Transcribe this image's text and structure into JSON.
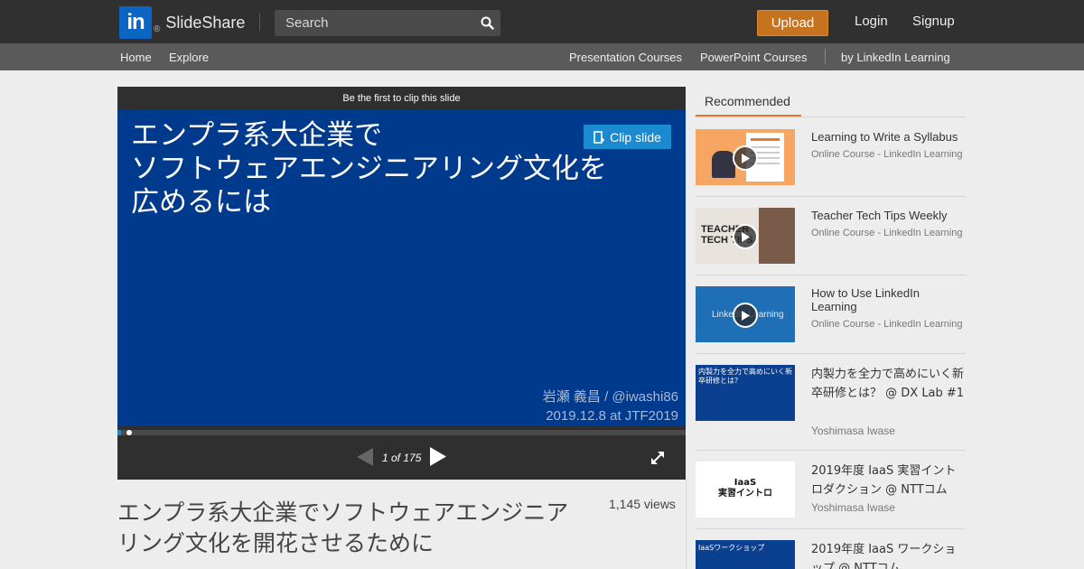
{
  "header": {
    "logo_in": "in",
    "logo_reg": "®",
    "logo_text": "SlideShare",
    "search_placeholder": "Search",
    "upload_label": "Upload",
    "login_label": "Login",
    "signup_label": "Signup"
  },
  "subnav": {
    "home": "Home",
    "explore": "Explore",
    "presentation_courses": "Presentation Courses",
    "powerpoint_courses": "PowerPoint Courses",
    "linkedin_learning": "by LinkedIn Learning"
  },
  "player": {
    "clip_banner": "Be the first to clip this slide",
    "clip_button": "Clip slide",
    "slide_title_lines": [
      "エンプラ系大企業で",
      "ソフトウェアエンジニアリング文化を",
      "広めるには"
    ],
    "slide_author": "岩瀬 義昌 / @iwashi86",
    "slide_date": "2019.12.8 at JTF2019",
    "counter": "1 of 175",
    "current_slide": 1,
    "total_slides": 175
  },
  "deck": {
    "title": "エンプラ系大企業でソフトウェアエンジニアリング文化を開花させるために",
    "views": "1,145 views"
  },
  "sidebar": {
    "tab_label": "Recommended",
    "items": [
      {
        "title": "Learning to Write a Syllabus",
        "subtitle": "Online Course - LinkedIn Learning"
      },
      {
        "title": "Teacher Tech Tips Weekly",
        "subtitle": "Online Course - LinkedIn Learning",
        "thumb_text": "TEACHER TECH TIPS"
      },
      {
        "title": "How to Use LinkedIn Learning",
        "subtitle": "Online Course - LinkedIn Learning",
        "thumb_text": "LinkedIn Learning"
      },
      {
        "title": "内製力を全力で高めにいく新卒研修とは？ @ DX Lab #1",
        "subtitle": "Yoshimasa Iwase",
        "thumb_text": "内製力を全力で高めにいく新卒研修とは？"
      },
      {
        "title": "2019年度 IaaS 実習イントロダクション @ NTTコム",
        "subtitle": "Yoshimasa Iwase",
        "thumb_text": "IaaS 実習イントロ"
      },
      {
        "title": "2019年度 IaaS ワークショップ @ NTTコム",
        "subtitle": "",
        "thumb_text": "IaaSワークショップ"
      }
    ]
  },
  "colors": {
    "topbar": "#303030",
    "subnav": "#5a5a5a",
    "slide_bg": "#003a8c",
    "upload": "#c6731f",
    "clip_button": "#1a8bd0",
    "accent_tab": "#e07a30"
  },
  "icons": {
    "search": "magnifier-icon",
    "prev": "triangle-left-icon",
    "next": "triangle-right-icon",
    "fullscreen": "expand-arrows-icon",
    "clip": "clip-icon",
    "play": "play-icon"
  }
}
